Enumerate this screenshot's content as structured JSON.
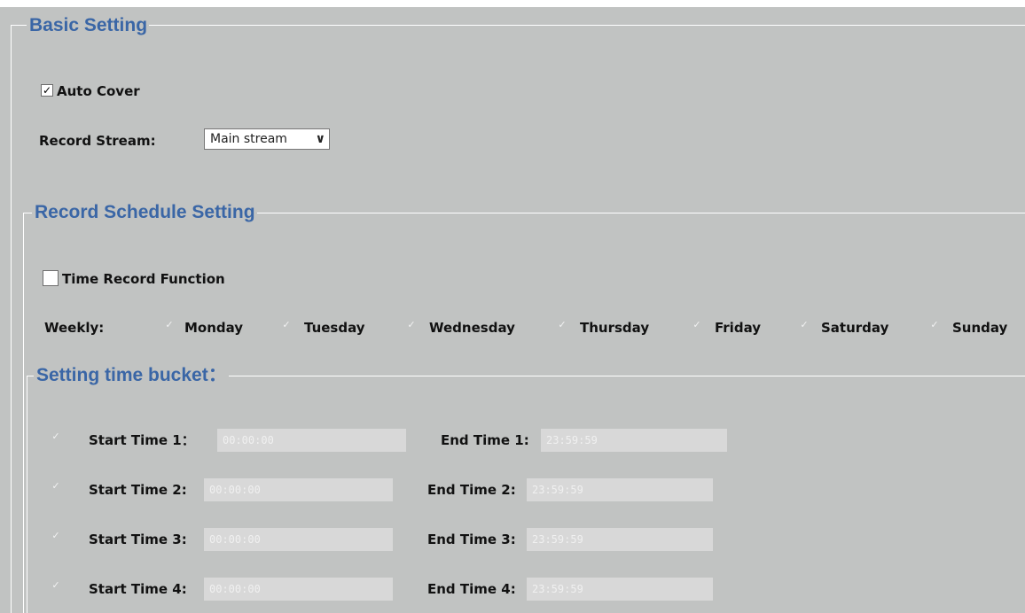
{
  "basic": {
    "title": "Basic Setting",
    "auto_cover_label": "Auto Cover",
    "auto_cover_checked": true,
    "record_stream_label": "Record Stream:",
    "record_stream_value": "Main stream"
  },
  "schedule": {
    "title": "Record Schedule Setting",
    "time_record_label": "Time Record Function",
    "time_record_checked": false,
    "weekly_label": "Weekly:",
    "days": [
      {
        "label": "Monday",
        "checked": true
      },
      {
        "label": "Tuesday",
        "checked": true
      },
      {
        "label": "Wednesday",
        "checked": true
      },
      {
        "label": "Thursday",
        "checked": true
      },
      {
        "label": "Friday",
        "checked": true
      },
      {
        "label": "Saturday",
        "checked": true
      },
      {
        "label": "Sunday",
        "checked": true
      }
    ]
  },
  "bucket": {
    "title": "Setting time bucket：",
    "rows": [
      {
        "start_label": "Start Time 1：",
        "start_value": "00:00:00",
        "end_label": "End Time 1:",
        "end_value": "23:59:59"
      },
      {
        "start_label": "Start Time 2:",
        "start_value": "00:00:00",
        "end_label": "End Time 2:",
        "end_value": "23:59:59"
      },
      {
        "start_label": "Start Time 3:",
        "start_value": "00:00:00",
        "end_label": "End Time 3:",
        "end_value": "23:59:59"
      },
      {
        "start_label": "Start Time 4:",
        "start_value": "00:00:00",
        "end_label": "End Time 4:",
        "end_value": "23:59:59"
      }
    ]
  },
  "icons": {
    "check": "✓"
  }
}
